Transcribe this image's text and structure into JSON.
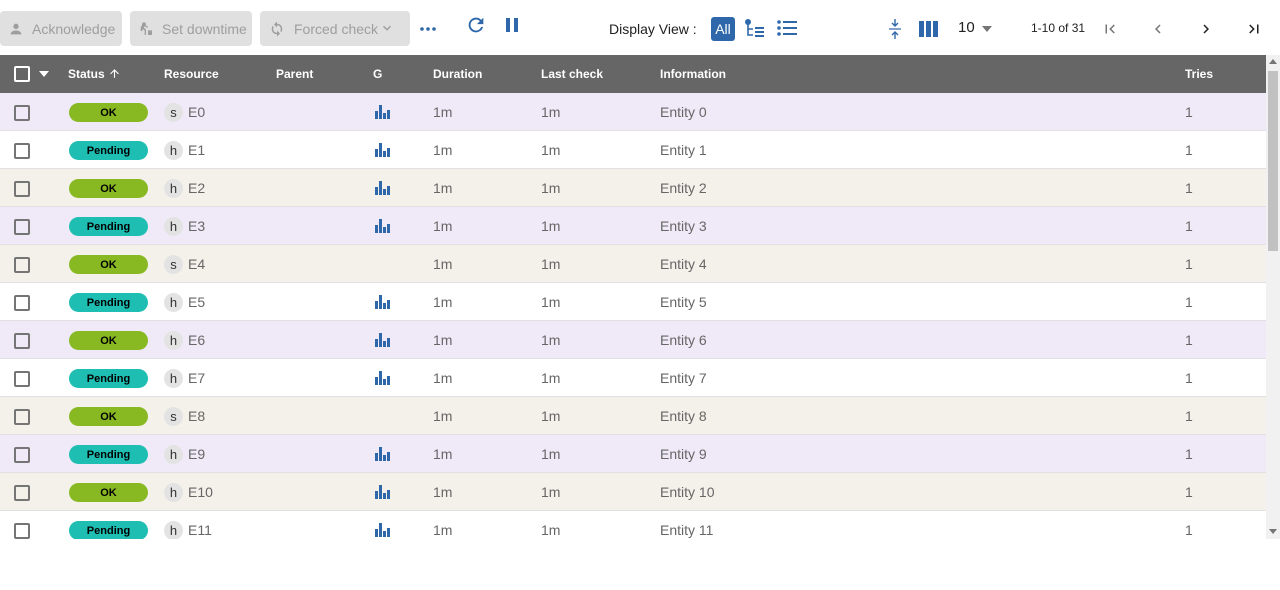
{
  "toolbar": {
    "acknowledge": "Acknowledge",
    "set_downtime": "Set downtime",
    "forced_check": "Forced check",
    "display_view_label": "Display View :",
    "display_view_all": "All",
    "per_page": "10",
    "range": "1-10 of 31"
  },
  "columns": {
    "status": "Status",
    "resource": "Resource",
    "parent": "Parent",
    "graph": "G",
    "duration": "Duration",
    "last_check": "Last check",
    "information": "Information",
    "tries": "Tries"
  },
  "rows": [
    {
      "status": "OK",
      "type": "s",
      "resource": "E0",
      "graph": true,
      "duration": "1m",
      "last_check": "1m",
      "information": "Entity 0",
      "tries": "1"
    },
    {
      "status": "Pending",
      "type": "h",
      "resource": "E1",
      "graph": true,
      "duration": "1m",
      "last_check": "1m",
      "information": "Entity 1",
      "tries": "1"
    },
    {
      "status": "OK",
      "type": "h",
      "resource": "E2",
      "graph": true,
      "duration": "1m",
      "last_check": "1m",
      "information": "Entity 2",
      "tries": "1"
    },
    {
      "status": "Pending",
      "type": "h",
      "resource": "E3",
      "graph": true,
      "duration": "1m",
      "last_check": "1m",
      "information": "Entity 3",
      "tries": "1"
    },
    {
      "status": "OK",
      "type": "s",
      "resource": "E4",
      "graph": false,
      "duration": "1m",
      "last_check": "1m",
      "information": "Entity 4",
      "tries": "1"
    },
    {
      "status": "Pending",
      "type": "h",
      "resource": "E5",
      "graph": true,
      "duration": "1m",
      "last_check": "1m",
      "information": "Entity 5",
      "tries": "1"
    },
    {
      "status": "OK",
      "type": "h",
      "resource": "E6",
      "graph": true,
      "duration": "1m",
      "last_check": "1m",
      "information": "Entity 6",
      "tries": "1"
    },
    {
      "status": "Pending",
      "type": "h",
      "resource": "E7",
      "graph": true,
      "duration": "1m",
      "last_check": "1m",
      "information": "Entity 7",
      "tries": "1"
    },
    {
      "status": "OK",
      "type": "s",
      "resource": "E8",
      "graph": false,
      "duration": "1m",
      "last_check": "1m",
      "information": "Entity 8",
      "tries": "1"
    },
    {
      "status": "Pending",
      "type": "h",
      "resource": "E9",
      "graph": true,
      "duration": "1m",
      "last_check": "1m",
      "information": "Entity 9",
      "tries": "1"
    },
    {
      "status": "OK",
      "type": "h",
      "resource": "E10",
      "graph": true,
      "duration": "1m",
      "last_check": "1m",
      "information": "Entity 10",
      "tries": "1"
    },
    {
      "status": "Pending",
      "type": "h",
      "resource": "E11",
      "graph": true,
      "duration": "1m",
      "last_check": "1m",
      "information": "Entity 11",
      "tries": "1"
    }
  ],
  "colors": {
    "ok": "#88b922",
    "pending": "#1ebeb3",
    "header_bg": "#666666",
    "accent": "#2e68aa"
  },
  "icons": {
    "acknowledge": "person-icon",
    "set_downtime": "downtime-icon",
    "forced_check": "forced-check-icon",
    "more": "more-horiz-icon",
    "refresh": "refresh-icon",
    "pause": "pause-icon",
    "tree_view": "tree-view-icon",
    "list_view": "list-view-icon",
    "compact": "compact-icon",
    "columns": "columns-icon",
    "first_page": "first-page-icon",
    "prev_page": "chevron-left-icon",
    "next_page": "chevron-right-icon",
    "last_page": "last-page-icon",
    "graph": "bar-chart-icon"
  }
}
